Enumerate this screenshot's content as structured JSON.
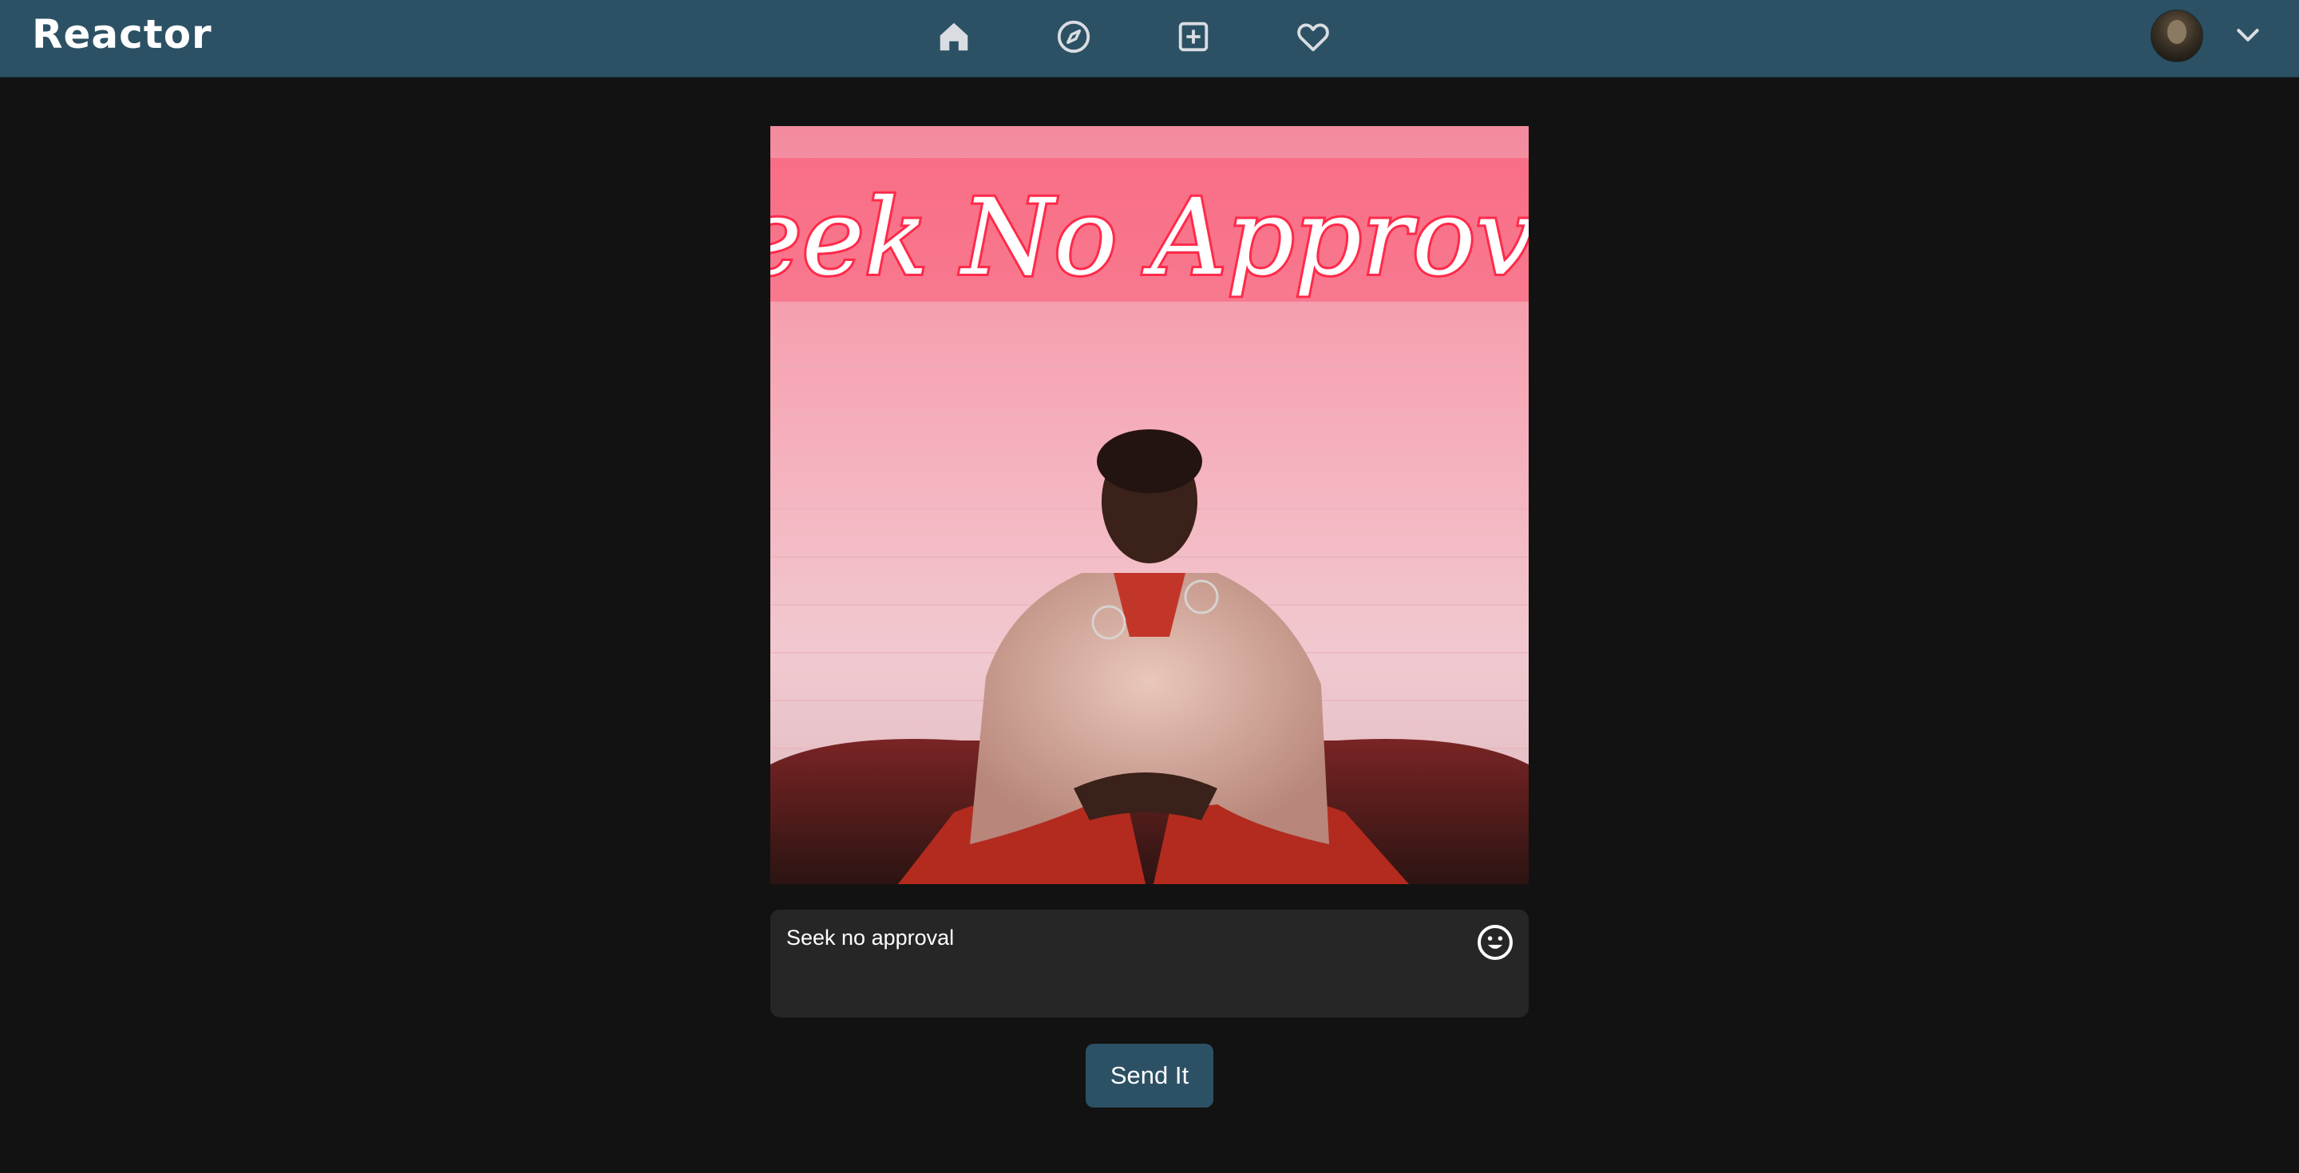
{
  "app": {
    "title": "Reactor"
  },
  "nav": {
    "icons": [
      "home-icon",
      "compass-icon",
      "add-post-icon",
      "heart-icon"
    ],
    "icon_color": "#d9dde2",
    "bar_color": "#2c5164"
  },
  "post": {
    "caption": "Seek no approval",
    "image_sign_text": "Seek No Approval"
  },
  "actions": {
    "send_label": "Send It"
  },
  "colors": {
    "background": "#121212",
    "accent": "#2c5164",
    "input_bg": "#262626"
  }
}
